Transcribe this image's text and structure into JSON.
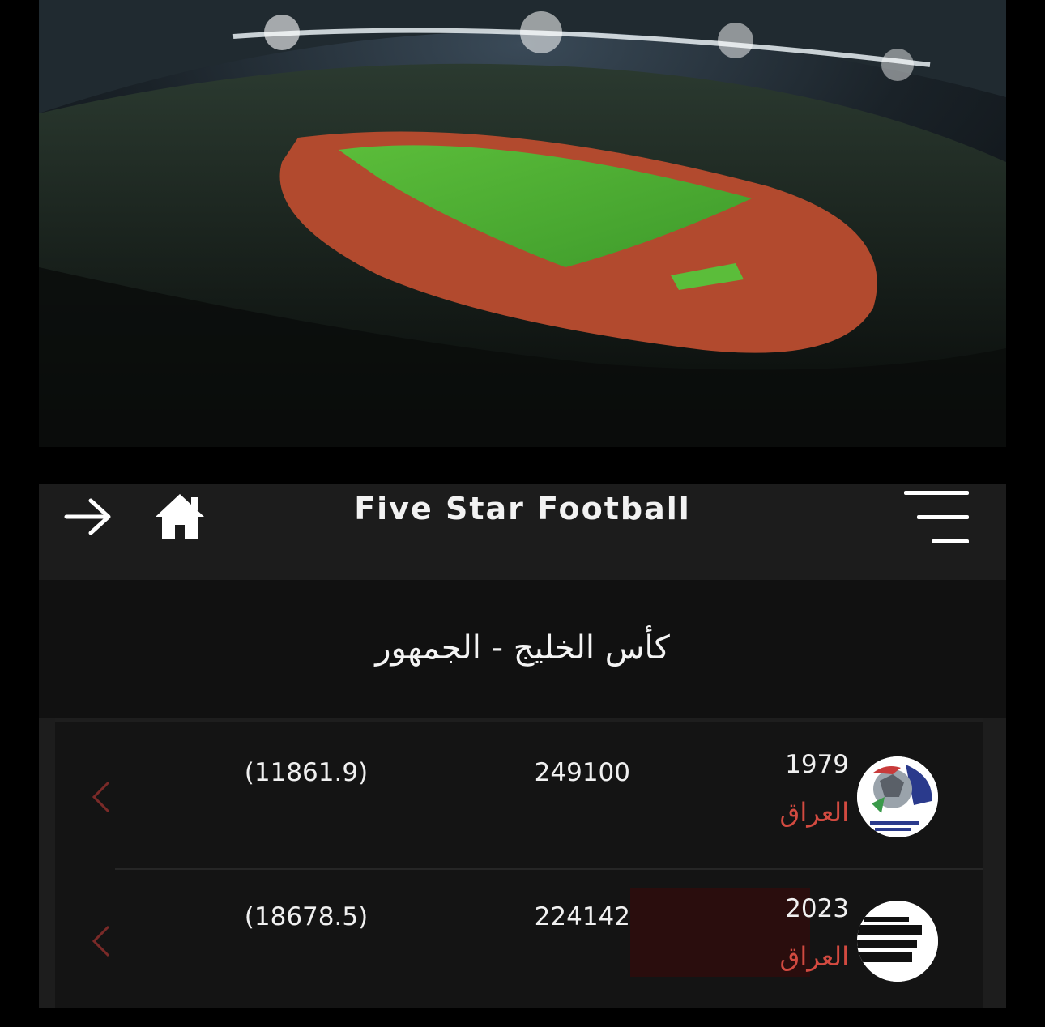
{
  "app": {
    "title": "Five Star Football"
  },
  "icons": {
    "back": "arrow-right-icon",
    "home": "home-icon",
    "menu": "menu-icon",
    "chevron": "chevron-left-icon"
  },
  "page": {
    "heading": "كأس الخليج - الجمهور"
  },
  "rows": [
    {
      "year": "1979",
      "country": "العراق",
      "total": "249100",
      "ratio": "(11861.9)"
    },
    {
      "year": "2023",
      "country": "العراق",
      "total": "224142",
      "ratio": "(18678.5)"
    }
  ],
  "colors": {
    "accent_red": "#d24a40",
    "chevron_red": "#7a2a28",
    "appbar": "#1c1c1c"
  }
}
